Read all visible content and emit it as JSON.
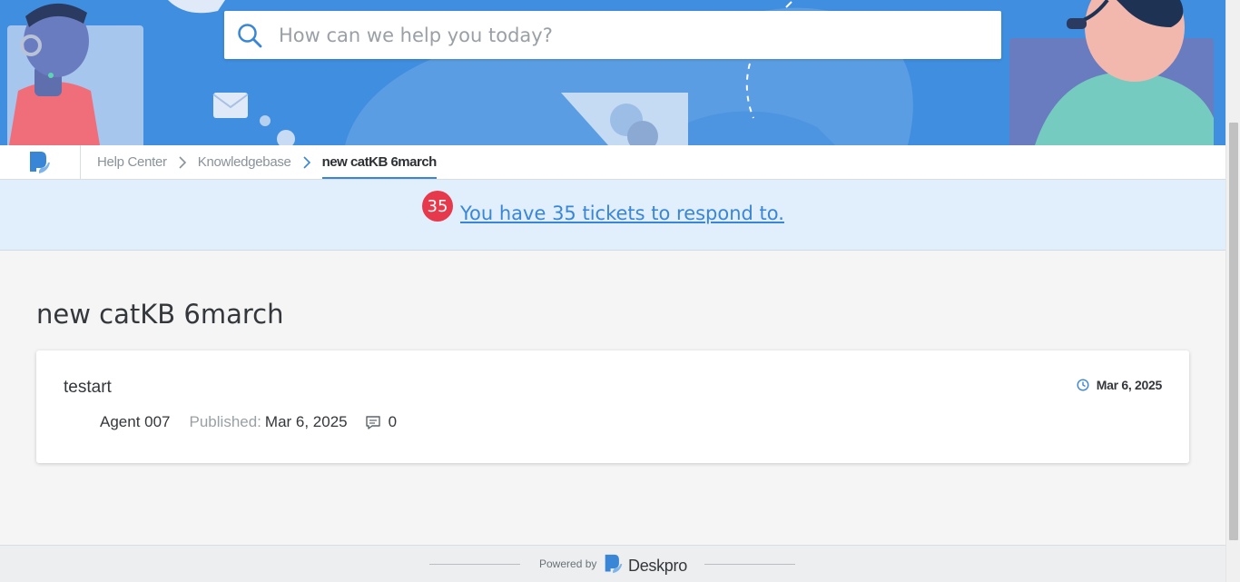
{
  "search": {
    "placeholder": "How can we help you today?"
  },
  "breadcrumb": {
    "items": [
      "Help Center",
      "Knowledgebase"
    ],
    "current": "new catKB 6march"
  },
  "notice": {
    "count": "35",
    "text": "You have 35 tickets to respond to."
  },
  "page": {
    "title": "new catKB 6march"
  },
  "article": {
    "title": "testart",
    "author": "Agent 007",
    "published_label": "Published:",
    "published_date": "Mar 6, 2025",
    "comments": "0",
    "date": "Mar 6, 2025"
  },
  "footer": {
    "powered_by": "Powered by",
    "brand": "Deskpro"
  },
  "colors": {
    "hero": "#3f8ee0",
    "accent": "#3a86d6",
    "badge": "#e6394c",
    "notice_bg": "#e1eefb"
  },
  "icons": [
    "search-icon",
    "deskpro-logo-icon",
    "chevron-right-icon",
    "clock-icon",
    "comment-icon"
  ]
}
